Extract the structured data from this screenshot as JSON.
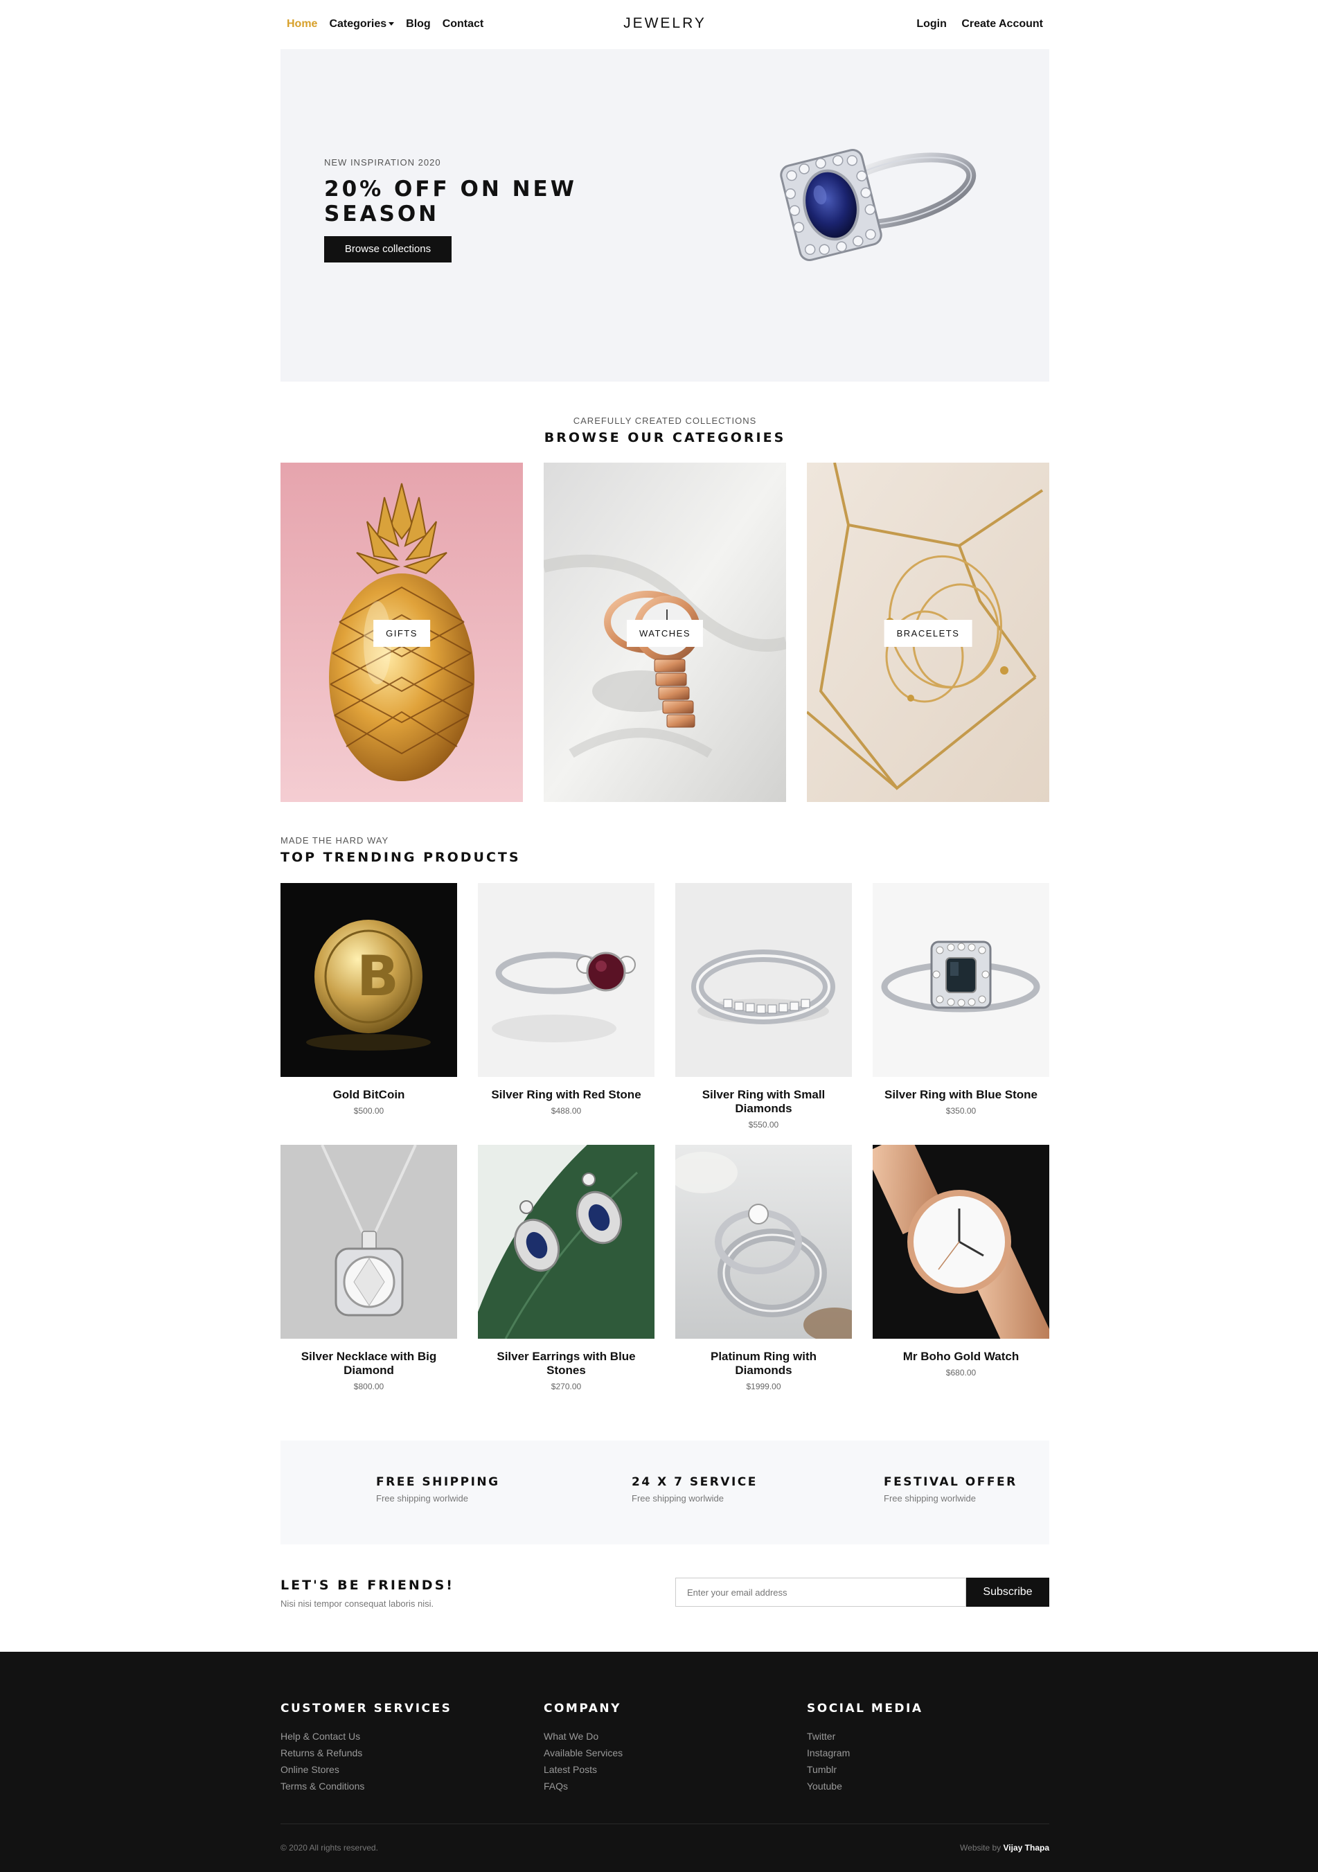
{
  "nav": {
    "links": [
      "Home",
      "Categories",
      "Blog",
      "Contact"
    ],
    "brand": "JEWELRY",
    "login": "Login",
    "create_account": "Create Account",
    "active_color": "#d7a02b"
  },
  "hero": {
    "subtitle": "NEW INSPIRATION 2020",
    "title": "20% OFF ON NEW SEASON",
    "button": "Browse collections"
  },
  "categories": {
    "subtitle": "CAREFULLY CREATED COLLECTIONS",
    "title": "BROWSE OUR CATEGORIES",
    "items": [
      "GIFTS",
      "WATCHES",
      "BRACELETS"
    ]
  },
  "products": {
    "subtitle": "MADE THE HARD WAY",
    "title": "TOP TRENDING PRODUCTS",
    "items": [
      {
        "name": "Gold BitCoin",
        "price": "$500.00"
      },
      {
        "name": "Silver Ring with Red Stone",
        "price": "$488.00"
      },
      {
        "name": "Silver Ring with Small Diamonds",
        "price": "$550.00"
      },
      {
        "name": "Silver Ring with Blue Stone",
        "price": "$350.00"
      },
      {
        "name": "Silver Necklace with Big Diamond",
        "price": "$800.00"
      },
      {
        "name": "Silver Earrings with Blue Stones",
        "price": "$270.00"
      },
      {
        "name": "Platinum Ring with Diamonds",
        "price": "$1999.00"
      },
      {
        "name": "Mr Boho Gold Watch",
        "price": "$680.00"
      }
    ]
  },
  "features": [
    {
      "title": "FREE SHIPPING",
      "desc": "Free shipping worlwide"
    },
    {
      "title": "24 X 7 SERVICE",
      "desc": "Free shipping worlwide"
    },
    {
      "title": "FESTIVAL OFFER",
      "desc": "Free shipping worlwide"
    }
  ],
  "newsletter": {
    "title": "LET'S BE FRIENDS!",
    "desc": "Nisi nisi tempor consequat laboris nisi.",
    "placeholder": "Enter your email address",
    "button": "Subscribe"
  },
  "footer": {
    "columns": [
      {
        "title": "CUSTOMER SERVICES",
        "links": [
          "Help & Contact Us",
          "Returns & Refunds",
          "Online Stores",
          "Terms & Conditions"
        ]
      },
      {
        "title": "COMPANY",
        "links": [
          "What We Do",
          "Available Services",
          "Latest Posts",
          "FAQs"
        ]
      },
      {
        "title": "SOCIAL MEDIA",
        "links": [
          "Twitter",
          "Instagram",
          "Tumblr",
          "Youtube"
        ]
      }
    ],
    "copyright": "© 2020 All rights reserved.",
    "credit_prefix": "Website by",
    "credit_name": "Vijay Thapa"
  }
}
